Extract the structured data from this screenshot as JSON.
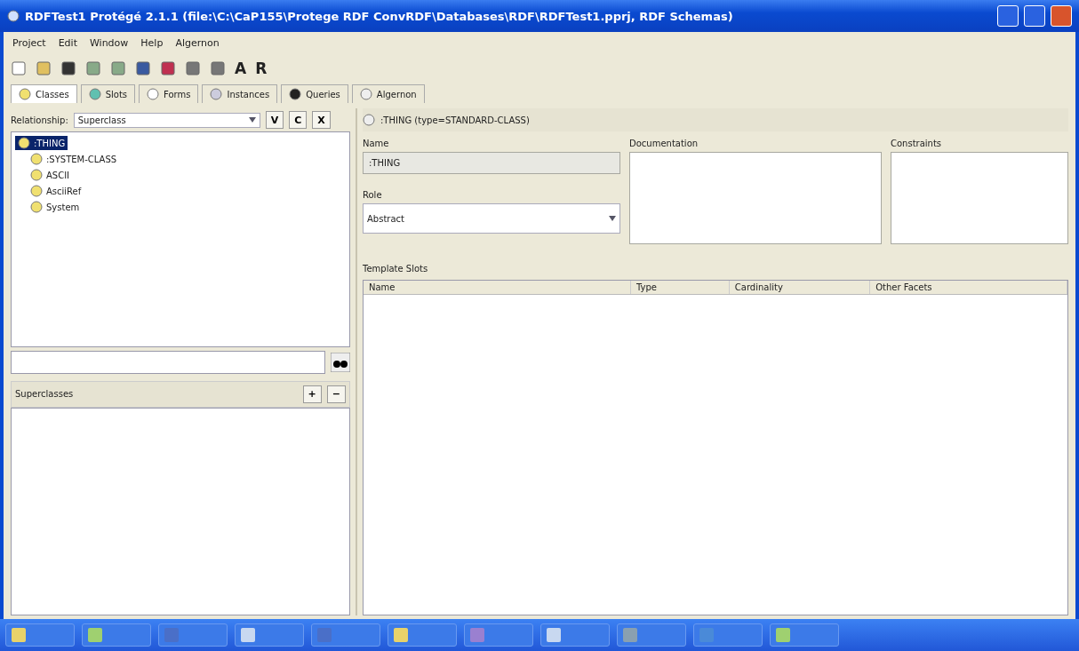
{
  "window": {
    "title": "RDFTest1  Protégé 2.1.1     (file:\\C:\\CaP155\\Protege RDF ConvRDF\\Databases\\RDF\\RDFTest1.pprj, RDF Schemas)"
  },
  "menu": [
    "Project",
    "Edit",
    "Window",
    "Help",
    "Algernon"
  ],
  "toolbar": {
    "letters": [
      "A",
      "R"
    ]
  },
  "tabs": [
    {
      "label": "Classes",
      "selected": true
    },
    {
      "label": "Slots",
      "selected": false
    },
    {
      "label": "Forms",
      "selected": false
    },
    {
      "label": "Instances",
      "selected": false
    },
    {
      "label": "Queries",
      "selected": false
    },
    {
      "label": "Algernon",
      "selected": false
    }
  ],
  "class_browser": {
    "relationship_label": "Relationship:",
    "relationship_value": "Superclass",
    "tool_buttons": [
      "V",
      "C",
      "X"
    ],
    "tree": [
      {
        "label": ":THING",
        "selected": true,
        "children": [
          {
            "label": ":SYSTEM-CLASS",
            "selected": false
          },
          {
            "label": "ASCII",
            "selected": false
          },
          {
            "label": "AsciiRef",
            "selected": false
          },
          {
            "label": "System",
            "selected": false
          }
        ]
      }
    ]
  },
  "superclasses": {
    "title": "Superclasses",
    "buttons": [
      "+",
      "−"
    ]
  },
  "class_editor": {
    "header": ":THING     (type=STANDARD-CLASS)",
    "name_label": "Name",
    "name_value": ":THING",
    "role_label": "Role",
    "role_value": "Abstract",
    "documentation_label": "Documentation",
    "constraints_label": "Constraints",
    "template_slots_label": "Template Slots",
    "columns": [
      "Name",
      "Type",
      "Cardinality",
      "Other Facets"
    ]
  },
  "taskbar": {
    "buttons": [
      {
        "color": "#e8d26a"
      },
      {
        "color": "#9fd070"
      },
      {
        "color": "#4a6fc8"
      },
      {
        "color": "#c8d8f0"
      },
      {
        "color": "#4a6fc8"
      },
      {
        "color": "#e8d26a"
      },
      {
        "color": "#9a80d0"
      },
      {
        "color": "#c8d8f0"
      },
      {
        "color": "#8aa0b0"
      },
      {
        "color": "#4a8ad8"
      },
      {
        "color": "#9fd070"
      }
    ]
  }
}
